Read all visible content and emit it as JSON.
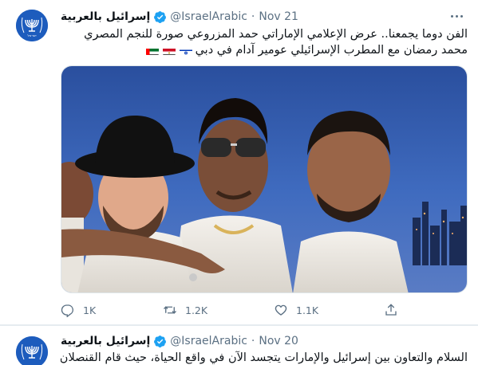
{
  "tweets": [
    {
      "display_name": "إسرائيل بالعربية",
      "handle": "@IsraelArabic",
      "separator": "·",
      "date": "Nov 21",
      "text_line1": "الفن دوما يجمعنا.. عرض الإعلامي الإماراتي حمد المزروعي صورة للنجم المصري",
      "text_line2": "محمد رمضان مع المطرب الإسرائيلي عومير آدام في دبي",
      "flags": [
        "israel-flag",
        "egypt-flag",
        "uae-flag"
      ],
      "actions": {
        "reply_count": "1K",
        "retweet_count": "1.2K",
        "like_count": "1.1K"
      }
    },
    {
      "display_name": "إسرائيل بالعربية",
      "handle": "@IsraelArabic",
      "separator": "·",
      "date": "Nov 20",
      "text_line1": "السلام والتعاون بين إسرائيل والإمارات يتجسد الآن في واقع الحياة، حيث قام القنصلان"
    }
  ],
  "icons": [
    "menorah-emblem-icon",
    "verified-badge-icon",
    "more-options-icon",
    "reply-icon",
    "retweet-icon",
    "like-icon",
    "share-icon"
  ],
  "colors": {
    "avatar_bg": "#1d5cbd",
    "verified": "#1da1f2",
    "muted_text": "#5b7083",
    "divider": "#e6ecf0"
  }
}
